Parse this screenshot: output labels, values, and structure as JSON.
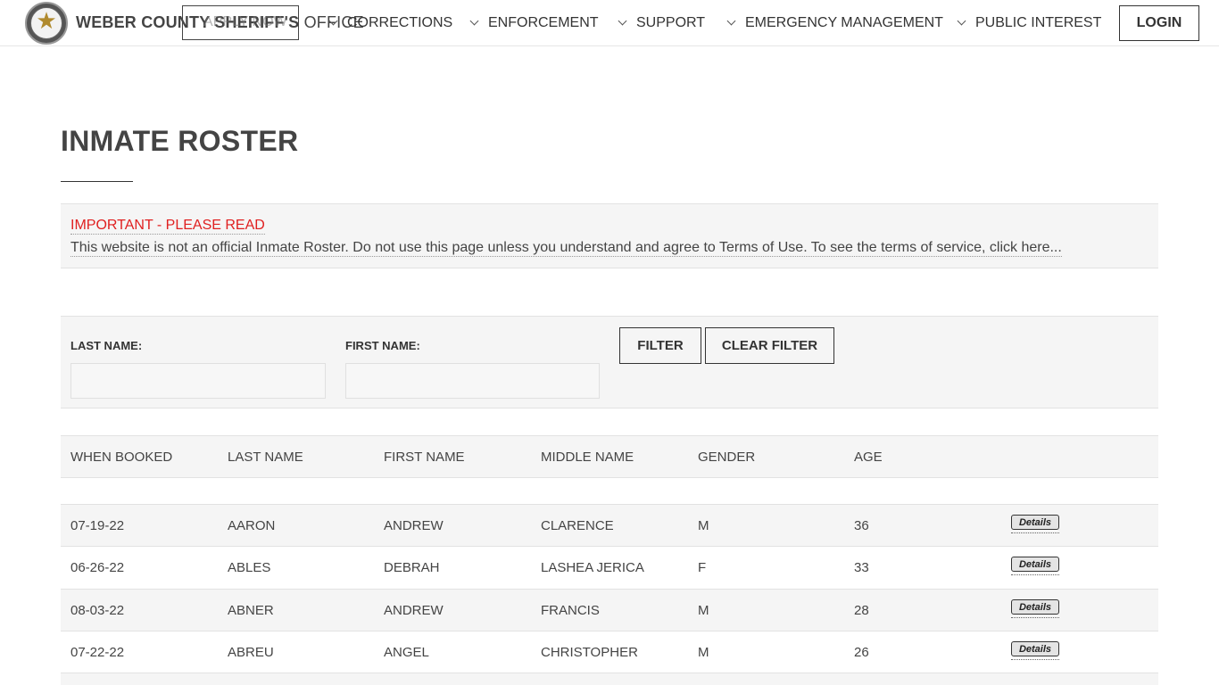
{
  "header": {
    "logo_icon": "sheriff-badge-icon",
    "site_title_main": "WEBER COUNTY SHERIFF'S",
    "site_title_office": " OFFICE",
    "overlap_text": "APPLY NOW",
    "nav": [
      {
        "label": "CORRECTIONS"
      },
      {
        "label": "ENFORCEMENT"
      },
      {
        "label": "SUPPORT"
      },
      {
        "label": "EMERGENCY MANAGEMENT"
      },
      {
        "label": "PUBLIC INTEREST"
      }
    ],
    "login_label": "LOGIN"
  },
  "page": {
    "title": "INMATE ROSTER"
  },
  "notice": {
    "heading": "IMPORTANT - PLEASE READ",
    "body": "This website is not an official Inmate Roster. Do not use this page unless you understand and agree to Terms of Use. To see the terms of service, click here..."
  },
  "filter": {
    "last_name_label": "LAST NAME:",
    "last_name_value": "",
    "first_name_label": "FIRST NAME:",
    "first_name_value": "",
    "filter_button": "FILTER",
    "clear_button": "CLEAR FILTER"
  },
  "table": {
    "columns": [
      "WHEN BOOKED",
      "LAST NAME",
      "FIRST NAME",
      "MIDDLE NAME",
      "GENDER",
      "AGE"
    ],
    "details_label": "Details",
    "rows": [
      {
        "booked": "07-19-22",
        "last": "AARON",
        "first": "ANDREW",
        "middle": "CLARENCE",
        "gender": "M",
        "age": "36"
      },
      {
        "booked": "06-26-22",
        "last": "ABLES",
        "first": "DEBRAH",
        "middle": "LASHEA JERICA",
        "gender": "F",
        "age": "33"
      },
      {
        "booked": "08-03-22",
        "last": "ABNER",
        "first": "ANDREW",
        "middle": "FRANCIS",
        "gender": "M",
        "age": "28"
      },
      {
        "booked": "07-22-22",
        "last": "ABREU",
        "first": "ANGEL",
        "middle": "CHRISTOPHER",
        "gender": "M",
        "age": "26"
      }
    ]
  },
  "colors": {
    "accent_red": "#e02020",
    "panel_bg": "#f5f5f5",
    "text": "#444444"
  }
}
